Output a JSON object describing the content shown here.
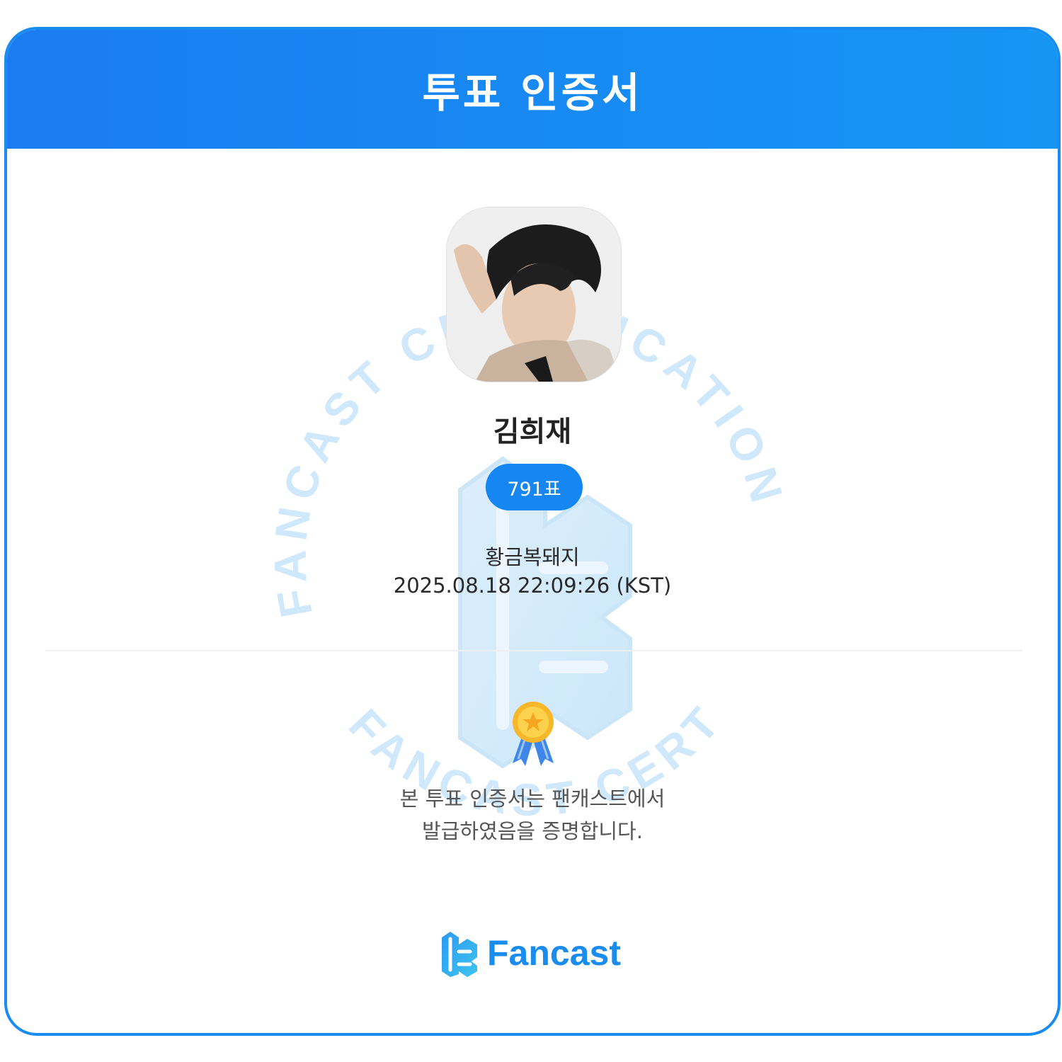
{
  "header": {
    "title": "투표 인증서"
  },
  "watermark": {
    "ring_text": "FANCAST CERTIFICATION",
    "lower_text": "FANCAST CERTIFICATION"
  },
  "artist": {
    "name": "김희재",
    "votes": "791표"
  },
  "voter": {
    "nickname": "황금복돼지",
    "datetime": "2025.08.18 22:09:26 (KST)"
  },
  "certificate": {
    "line1": "본 투표 인증서는 팬캐스트에서",
    "line2": "발급하였음을 증명합니다."
  },
  "footer": {
    "logo_text": "Fancast"
  },
  "colors": {
    "accent": "#1a8cf0",
    "header_start": "#1a7cf0",
    "header_end": "#1596f5",
    "badge": "#1586f2",
    "watermark": "#cfe8fb"
  },
  "icons": {
    "medal": "medal-icon",
    "logo": "fancast-logo-icon"
  }
}
